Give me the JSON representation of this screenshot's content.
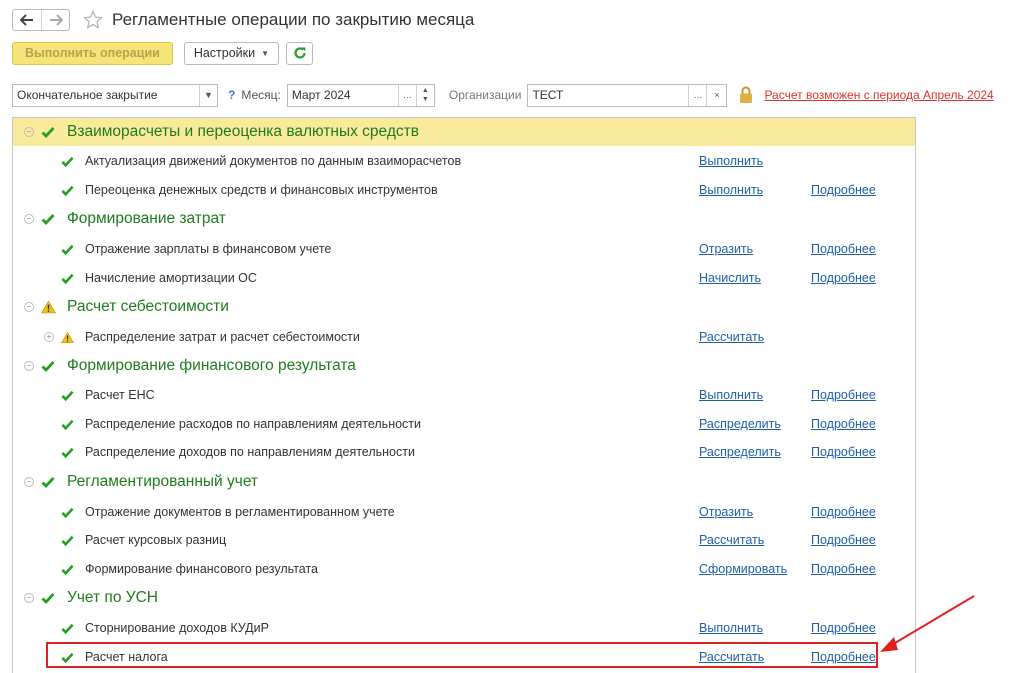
{
  "header": {
    "title": "Регламентные операции по закрытию месяца",
    "back_icon": "arrow-left-icon",
    "forward_icon": "arrow-right-icon",
    "favorite_icon": "star-icon"
  },
  "toolbar": {
    "run_label": "Выполнить операции",
    "settings_label": "Настройки",
    "refresh_icon": "refresh-icon"
  },
  "filters": {
    "mode_value": "Окончательное закрытие",
    "help_label": "?",
    "month_label": "Месяц:",
    "month_value": "Март 2024",
    "org_label": "Организации",
    "org_value": "ТЕСТ",
    "warning_link": "Расчет возможен с периода Апрель 2024"
  },
  "list": {
    "groups": [
      {
        "title": "Взаиморасчеты и переоценка валютных средств",
        "status": "ok",
        "items": [
          {
            "title": "Актуализация движений документов по данным взаиморасчетов",
            "action": "Выполнить",
            "more": ""
          },
          {
            "title": "Переоценка денежных средств и финансовых инструментов",
            "action": "Выполнить",
            "more": "Подробнее"
          }
        ]
      },
      {
        "title": "Формирование затрат",
        "status": "ok",
        "items": [
          {
            "title": "Отражение зарплаты в финансовом учете",
            "action": "Отразить",
            "more": "Подробнее"
          },
          {
            "title": "Начисление амортизации ОС",
            "action": "Начислить",
            "more": "Подробнее"
          }
        ]
      },
      {
        "title": "Расчет себестоимости",
        "status": "warning",
        "items": [
          {
            "title": "Распределение затрат и расчет себестоимости",
            "action": "Рассчитать",
            "more": ""
          }
        ]
      },
      {
        "title": "Формирование финансового результата",
        "status": "ok",
        "items": [
          {
            "title": "Расчет ЕНС",
            "action": "Выполнить",
            "more": "Подробнее"
          },
          {
            "title": "Распределение расходов по направлениям деятельности",
            "action": "Распределить",
            "more": "Подробнее"
          },
          {
            "title": "Распределение доходов по направлениям деятельности",
            "action": "Распределить",
            "more": "Подробнее"
          }
        ]
      },
      {
        "title": "Регламентированный учет",
        "status": "ok",
        "items": [
          {
            "title": "Отражение документов в регламентированном учете",
            "action": "Отразить",
            "more": "Подробнее"
          },
          {
            "title": "Расчет курсовых разниц",
            "action": "Рассчитать",
            "more": "Подробнее"
          },
          {
            "title": "Формирование финансового результата",
            "action": "Сформировать",
            "more": "Подробнее"
          }
        ]
      },
      {
        "title": "Учет по УСН",
        "status": "ok",
        "items": [
          {
            "title": "Сторнирование доходов КУДиР",
            "action": "Выполнить",
            "more": "Подробнее"
          },
          {
            "title": "Расчет налога",
            "action": "Рассчитать",
            "more": "Подробнее"
          }
        ]
      }
    ]
  },
  "colors": {
    "group_title": "#1e7c1e",
    "selected_group_bg": "#faeb9c",
    "link": "#1f5fa8",
    "warning_link": "#e0332a",
    "annotation": "#e32020"
  }
}
